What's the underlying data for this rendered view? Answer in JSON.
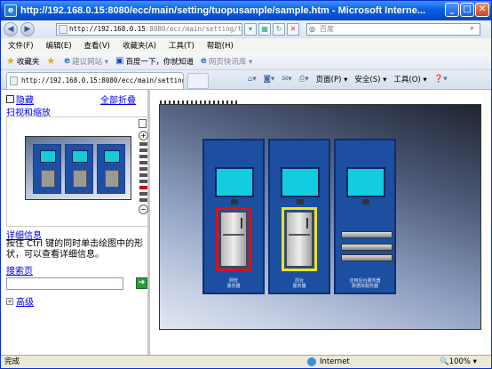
{
  "window": {
    "title": "http://192.168.0.15:8080/ecc/main/setting/tuopusample/sample.htm - Microsoft Interne...",
    "min_glyph": "_",
    "max_glyph": "□",
    "close_glyph": "✕"
  },
  "address": {
    "host": "http://192.168.0.15",
    "rest": ":8080/ecc/main/setting/tuop"
  },
  "search": {
    "placeholder": "百度"
  },
  "menu": [
    "文件(F)",
    "编辑(E)",
    "查看(V)",
    "收藏夹(A)",
    "工具(T)",
    "帮助(H)"
  ],
  "favorites": {
    "fav_label": "收藏夹",
    "suggested": "建议网站 ▾",
    "baidu": "百度一下，你就知道",
    "webslice": "网页快讯库 ▾"
  },
  "tab": {
    "label": "http://192.168.0.15:8080/ecc/main/setting..."
  },
  "commands": {
    "page": "页面(P) ▾",
    "safety": "安全(S) ▾",
    "tools": "工具(O) ▾",
    "help": "❓▾"
  },
  "left_panel": {
    "hide_label": "隐藏",
    "fold_all": "全部折叠",
    "pan_zoom": "扫视和缩放",
    "detail_title": "详细信息",
    "detail_text": "按住 Ctrl 键的同时单击绘图中的形状，可以查看详细信息。",
    "search_title": "搜索页",
    "go_glyph": "➔",
    "advanced": "高级"
  },
  "drawing": {
    "racks": [
      {
        "label": "网管\n服务器",
        "highlight": "red"
      },
      {
        "label": "前台\n服务器",
        "highlight": "yellow"
      },
      {
        "label": "应用后台服务器\n数据库服务器",
        "highlight": "none"
      }
    ]
  },
  "status": {
    "left": "完成",
    "zone": "Internet",
    "zoom": "🔍100% ▾"
  },
  "colors": {
    "title_bar": "#0a5fe0",
    "link": "#0000ee",
    "rack_blue": "#1c4fa0",
    "monitor_cyan": "#12cde0"
  }
}
